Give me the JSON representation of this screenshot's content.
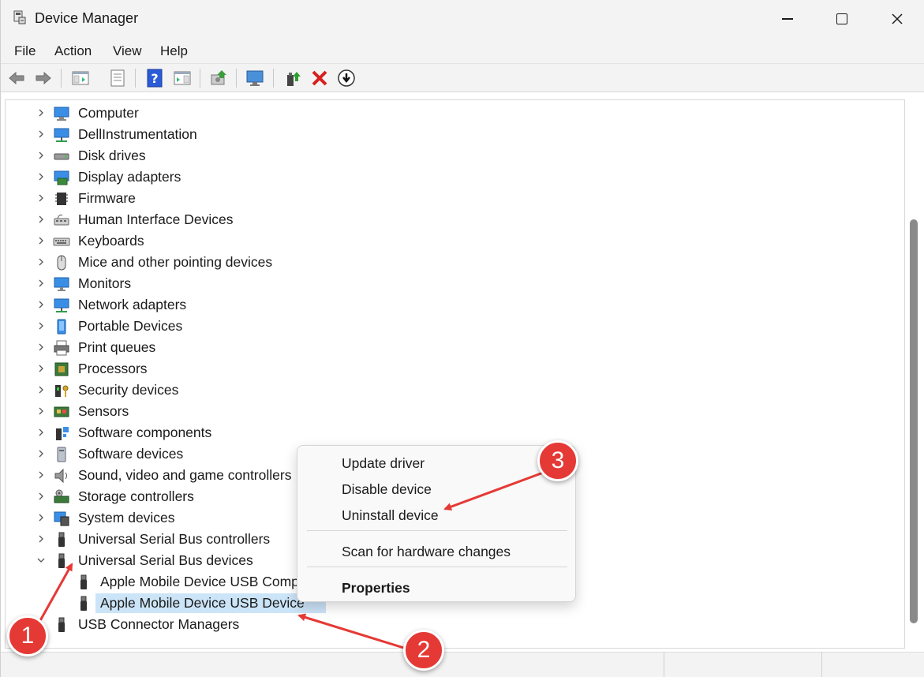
{
  "window": {
    "title": "Device Manager",
    "app_icon": "device-manager-icon"
  },
  "menu": {
    "file": "File",
    "action": "Action",
    "view": "View",
    "help": "Help"
  },
  "toolbar": {
    "icons": [
      "back-arrow-icon",
      "forward-arrow-icon",
      "show-hide-console-tree-icon",
      "properties-sheet-icon",
      "help-icon",
      "action-pane-icon",
      "scan-hardware-icon",
      "monitor-icon",
      "update-driver-icon",
      "uninstall-icon",
      "download-icon"
    ]
  },
  "tree": {
    "categories": [
      {
        "label": "Computer",
        "icon": "computer-icon"
      },
      {
        "label": "DellInstrumentation",
        "icon": "network-monitor-icon"
      },
      {
        "label": "Disk drives",
        "icon": "disk-drive-icon"
      },
      {
        "label": "Display adapters",
        "icon": "display-adapter-icon"
      },
      {
        "label": "Firmware",
        "icon": "chip-icon"
      },
      {
        "label": "Human Interface Devices",
        "icon": "hid-icon"
      },
      {
        "label": "Keyboards",
        "icon": "keyboard-icon"
      },
      {
        "label": "Mice and other pointing devices",
        "icon": "mouse-icon"
      },
      {
        "label": "Monitors",
        "icon": "monitor-icon"
      },
      {
        "label": "Network adapters",
        "icon": "network-adapter-icon"
      },
      {
        "label": "Portable Devices",
        "icon": "portable-device-icon"
      },
      {
        "label": "Print queues",
        "icon": "printer-icon"
      },
      {
        "label": "Processors",
        "icon": "processor-icon"
      },
      {
        "label": "Security devices",
        "icon": "security-key-icon"
      },
      {
        "label": "Sensors",
        "icon": "sensor-icon"
      },
      {
        "label": "Software components",
        "icon": "software-component-icon"
      },
      {
        "label": "Software devices",
        "icon": "software-device-icon"
      },
      {
        "label": "Sound, video and game controllers",
        "icon": "speaker-icon"
      },
      {
        "label": "Storage controllers",
        "icon": "storage-controller-icon"
      },
      {
        "label": "System devices",
        "icon": "system-device-icon"
      },
      {
        "label": "Universal Serial Bus controllers",
        "icon": "usb-plug-icon"
      },
      {
        "label": "Universal Serial Bus devices",
        "icon": "usb-plug-icon",
        "expanded": true
      },
      {
        "label": "Apple Mobile Device USB Comp",
        "icon": "usb-plug-icon",
        "child": true
      },
      {
        "label": "Apple Mobile Device USB Device",
        "icon": "usb-plug-icon",
        "child": true,
        "selected": true
      },
      {
        "label": "USB Connector Managers",
        "icon": "usb-plug-icon"
      }
    ]
  },
  "context_menu": {
    "update_driver": "Update driver",
    "disable_device": "Disable device",
    "uninstall_device": "Uninstall device",
    "scan_hardware": "Scan for hardware changes",
    "properties": "Properties"
  },
  "annotations": {
    "step1": "1",
    "step2": "2",
    "step3": "3",
    "color": "#e53935"
  },
  "colors": {
    "selection": "#cce4f7",
    "chrome": "#f3f3f3"
  }
}
